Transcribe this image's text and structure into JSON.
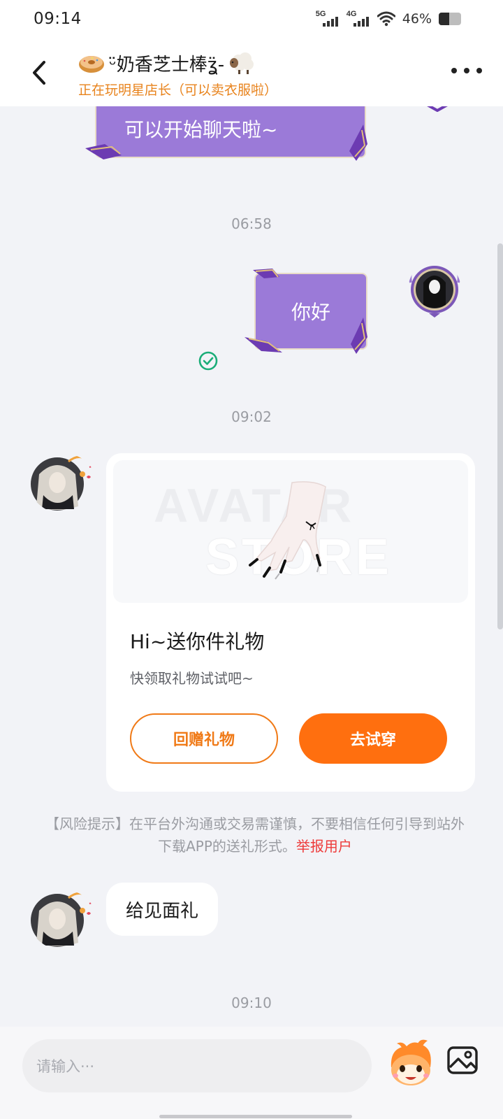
{
  "status_bar": {
    "time": "09:14",
    "network_5g": "5G",
    "network_4g": "4G",
    "battery": "46%",
    "battery_level_percent": 46,
    "icons": [
      "signal-5g-icon",
      "signal-4g-icon",
      "wifi-icon",
      "battery-icon"
    ]
  },
  "header": {
    "back_icon": "chevron-left-icon",
    "title": "ᵕ̈奶香芝士棒ʓ̈-",
    "title_emoji_left": "donut-emoji",
    "title_emoji_right": "sheep-emoji",
    "subtitle": "正在玩明星店长（可以卖衣服啦）",
    "more_icon": "more-dots-icon"
  },
  "messages": {
    "top_bubble_text": "可以开始聊天啦~",
    "time_1": "06:58",
    "sent_text": "你好",
    "sent_status_icon": "check-circle-icon",
    "time_2": "09:02",
    "gift_card": {
      "watermark_1": "AVATAR",
      "watermark_2": "STORE",
      "title": "Hi~送你件礼物",
      "description": "快领取礼物试试吧~",
      "return_button": "回赠礼物",
      "try_button": "去试穿"
    },
    "risk_notice": "【风险提示】在平台外沟通或交易需谨慎，不要相信任何引导到站外下载APP的送礼形式。",
    "report_link": "举报用户",
    "received_text": "给见面礼",
    "time_3": "09:10"
  },
  "input_bar": {
    "placeholder": "请输入···",
    "mascot_icon": "mascot-emoji-icon",
    "image_icon": "image-icon"
  },
  "colors": {
    "accent_orange": "#ff6f0f",
    "subtitle_orange": "#e8831c",
    "bubble_purple": "#9b7ad8",
    "report_red": "#ee3a3a",
    "check_green": "#1aad78"
  }
}
